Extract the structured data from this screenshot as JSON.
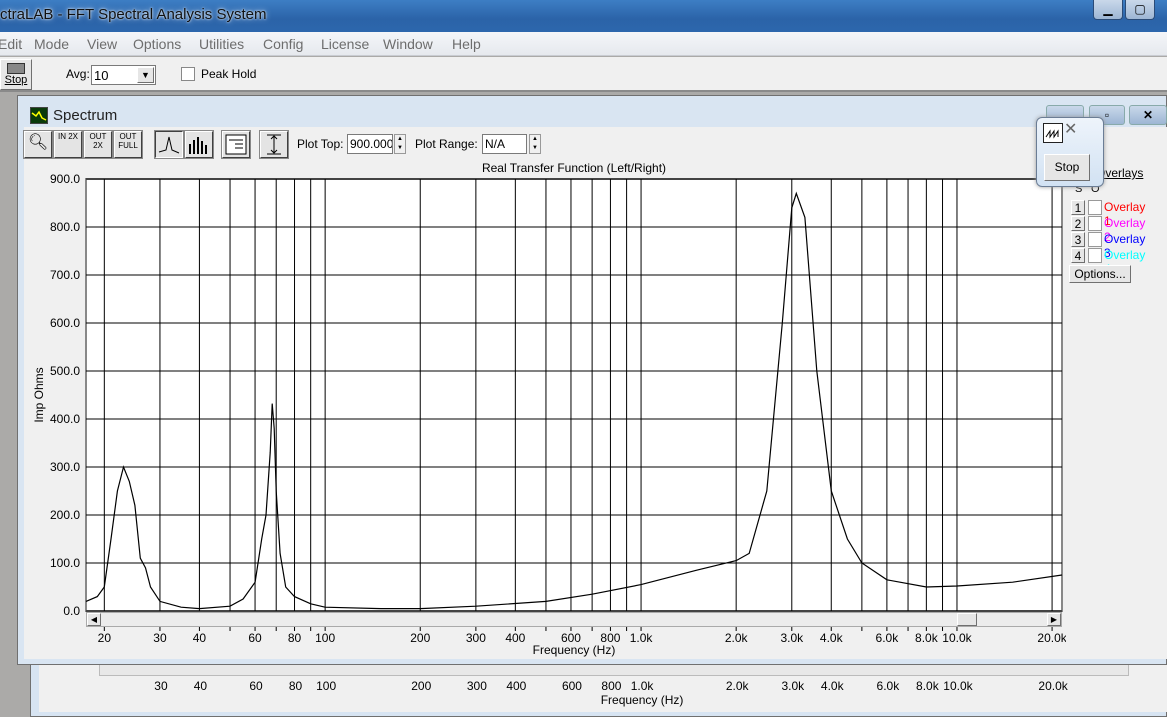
{
  "app": {
    "title": "ctraLAB - FFT Spectral Analysis System"
  },
  "menu": [
    "Edit",
    "Mode",
    "View",
    "Options",
    "Utilities",
    "Config",
    "License",
    "Window",
    "Help"
  ],
  "toolbar": {
    "stop_label": "Stop",
    "avg_label": "Avg:",
    "avg_value": "10",
    "peak_hold_label": "Peak Hold",
    "peak_hold_checked": false
  },
  "spectrum": {
    "title": "Spectrum",
    "plot_top_label": "Plot Top:",
    "plot_top_value": "900.000",
    "plot_range_label": "Plot Range:",
    "plot_range_value": "N/A",
    "tool_buttons": [
      "zoom",
      "zoom-in-2x",
      "zoom-out-2x",
      "zoom-out-full",
      "line-mode",
      "bar-mode",
      "display-settings",
      "auto-scale"
    ],
    "tool_labels": {
      "in2x": "IN 2X",
      "out2x": "OUT 2X",
      "outfull": "OUT FULL"
    }
  },
  "overlays": {
    "title": "Overlays",
    "col_s": "S",
    "col_o": "O",
    "options_label": "Options...",
    "items": [
      {
        "num": "1",
        "label": "Overlay 1",
        "color": "#ff0000"
      },
      {
        "num": "2",
        "label": "Overlay 2",
        "color": "#ff00ff"
      },
      {
        "num": "3",
        "label": "Overlay 3",
        "color": "#0000ff"
      },
      {
        "num": "4",
        "label": "Overlay 4",
        "color": "#00ffff"
      }
    ]
  },
  "popup": {
    "stop_label": "Stop"
  },
  "chart_data": {
    "type": "line",
    "title": "Real Transfer Function (Left/Right)",
    "xlabel": "Frequency (Hz)",
    "ylabel": "Imp Ohms",
    "xscale": "log",
    "xlim": [
      17.5,
      21500
    ],
    "ylim": [
      0,
      900
    ],
    "grid": true,
    "line_color": "#000000",
    "yticks": [
      "0.0",
      "100.0",
      "200.0",
      "300.0",
      "400.0",
      "500.0",
      "600.0",
      "700.0",
      "800.0",
      "900.0"
    ],
    "xticks": [
      {
        "v": 20,
        "l": "20"
      },
      {
        "v": 30,
        "l": "30"
      },
      {
        "v": 40,
        "l": "40"
      },
      {
        "v": 60,
        "l": "60"
      },
      {
        "v": 80,
        "l": "80"
      },
      {
        "v": 100,
        "l": "100"
      },
      {
        "v": 200,
        "l": "200"
      },
      {
        "v": 300,
        "l": "300"
      },
      {
        "v": 400,
        "l": "400"
      },
      {
        "v": 600,
        "l": "600"
      },
      {
        "v": 800,
        "l": "800"
      },
      {
        "v": 1000,
        "l": "1.0k"
      },
      {
        "v": 2000,
        "l": "2.0k"
      },
      {
        "v": 3000,
        "l": "3.0k"
      },
      {
        "v": 4000,
        "l": "4.0k"
      },
      {
        "v": 6000,
        "l": "6.0k"
      },
      {
        "v": 8000,
        "l": "8.0k"
      },
      {
        "v": 10000,
        "l": "10.0k"
      },
      {
        "v": 20000,
        "l": "20.0k"
      }
    ],
    "back_xticks": [
      "30",
      "40",
      "60",
      "80",
      "100",
      "200",
      "300",
      "400",
      "600",
      "800",
      "1.0k",
      "2.0k",
      "3.0k",
      "4.0k",
      "6.0k",
      "8.0k",
      "10.0k",
      "20.0k"
    ],
    "x": [
      17.5,
      19,
      20,
      21,
      22,
      23,
      24,
      25,
      26,
      27,
      28,
      30,
      35,
      40,
      50,
      55,
      60,
      63,
      65,
      67,
      68,
      69,
      70,
      72,
      75,
      80,
      90,
      100,
      150,
      200,
      300,
      500,
      700,
      1000,
      1500,
      2000,
      2200,
      2500,
      2800,
      3000,
      3100,
      3300,
      3600,
      4000,
      4500,
      5000,
      6000,
      8000,
      10000,
      15000,
      21500
    ],
    "y": [
      20,
      30,
      50,
      150,
      250,
      300,
      270,
      220,
      110,
      90,
      50,
      20,
      8,
      5,
      10,
      25,
      60,
      150,
      200,
      330,
      432,
      380,
      250,
      120,
      50,
      30,
      15,
      8,
      5,
      5,
      10,
      20,
      35,
      55,
      85,
      105,
      120,
      250,
      600,
      840,
      870,
      820,
      500,
      250,
      150,
      100,
      65,
      50,
      52,
      60,
      75
    ]
  }
}
